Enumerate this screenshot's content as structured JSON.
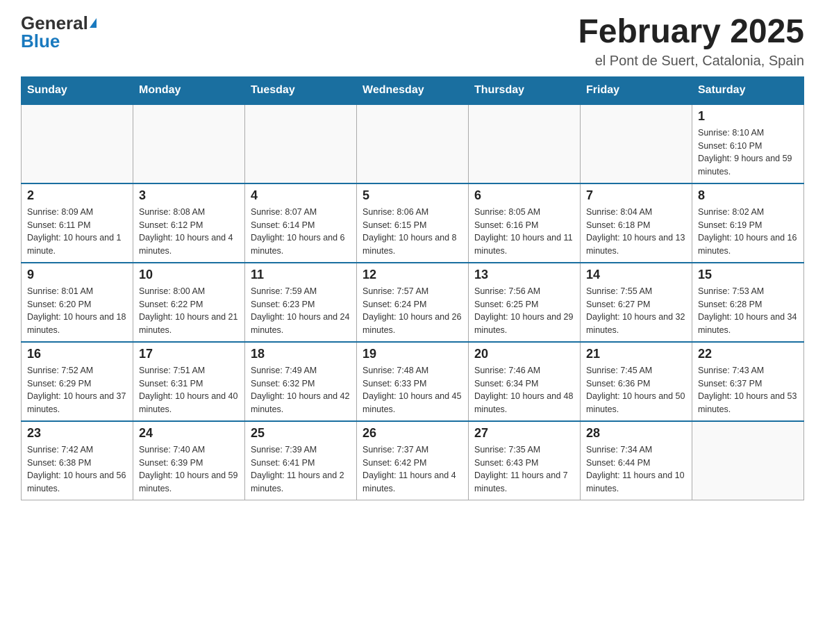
{
  "header": {
    "logo_general": "General",
    "logo_blue": "Blue",
    "title": "February 2025",
    "subtitle": "el Pont de Suert, Catalonia, Spain"
  },
  "days_of_week": [
    "Sunday",
    "Monday",
    "Tuesday",
    "Wednesday",
    "Thursday",
    "Friday",
    "Saturday"
  ],
  "weeks": [
    [
      {
        "day": "",
        "info": ""
      },
      {
        "day": "",
        "info": ""
      },
      {
        "day": "",
        "info": ""
      },
      {
        "day": "",
        "info": ""
      },
      {
        "day": "",
        "info": ""
      },
      {
        "day": "",
        "info": ""
      },
      {
        "day": "1",
        "info": "Sunrise: 8:10 AM\nSunset: 6:10 PM\nDaylight: 9 hours and 59 minutes."
      }
    ],
    [
      {
        "day": "2",
        "info": "Sunrise: 8:09 AM\nSunset: 6:11 PM\nDaylight: 10 hours and 1 minute."
      },
      {
        "day": "3",
        "info": "Sunrise: 8:08 AM\nSunset: 6:12 PM\nDaylight: 10 hours and 4 minutes."
      },
      {
        "day": "4",
        "info": "Sunrise: 8:07 AM\nSunset: 6:14 PM\nDaylight: 10 hours and 6 minutes."
      },
      {
        "day": "5",
        "info": "Sunrise: 8:06 AM\nSunset: 6:15 PM\nDaylight: 10 hours and 8 minutes."
      },
      {
        "day": "6",
        "info": "Sunrise: 8:05 AM\nSunset: 6:16 PM\nDaylight: 10 hours and 11 minutes."
      },
      {
        "day": "7",
        "info": "Sunrise: 8:04 AM\nSunset: 6:18 PM\nDaylight: 10 hours and 13 minutes."
      },
      {
        "day": "8",
        "info": "Sunrise: 8:02 AM\nSunset: 6:19 PM\nDaylight: 10 hours and 16 minutes."
      }
    ],
    [
      {
        "day": "9",
        "info": "Sunrise: 8:01 AM\nSunset: 6:20 PM\nDaylight: 10 hours and 18 minutes."
      },
      {
        "day": "10",
        "info": "Sunrise: 8:00 AM\nSunset: 6:22 PM\nDaylight: 10 hours and 21 minutes."
      },
      {
        "day": "11",
        "info": "Sunrise: 7:59 AM\nSunset: 6:23 PM\nDaylight: 10 hours and 24 minutes."
      },
      {
        "day": "12",
        "info": "Sunrise: 7:57 AM\nSunset: 6:24 PM\nDaylight: 10 hours and 26 minutes."
      },
      {
        "day": "13",
        "info": "Sunrise: 7:56 AM\nSunset: 6:25 PM\nDaylight: 10 hours and 29 minutes."
      },
      {
        "day": "14",
        "info": "Sunrise: 7:55 AM\nSunset: 6:27 PM\nDaylight: 10 hours and 32 minutes."
      },
      {
        "day": "15",
        "info": "Sunrise: 7:53 AM\nSunset: 6:28 PM\nDaylight: 10 hours and 34 minutes."
      }
    ],
    [
      {
        "day": "16",
        "info": "Sunrise: 7:52 AM\nSunset: 6:29 PM\nDaylight: 10 hours and 37 minutes."
      },
      {
        "day": "17",
        "info": "Sunrise: 7:51 AM\nSunset: 6:31 PM\nDaylight: 10 hours and 40 minutes."
      },
      {
        "day": "18",
        "info": "Sunrise: 7:49 AM\nSunset: 6:32 PM\nDaylight: 10 hours and 42 minutes."
      },
      {
        "day": "19",
        "info": "Sunrise: 7:48 AM\nSunset: 6:33 PM\nDaylight: 10 hours and 45 minutes."
      },
      {
        "day": "20",
        "info": "Sunrise: 7:46 AM\nSunset: 6:34 PM\nDaylight: 10 hours and 48 minutes."
      },
      {
        "day": "21",
        "info": "Sunrise: 7:45 AM\nSunset: 6:36 PM\nDaylight: 10 hours and 50 minutes."
      },
      {
        "day": "22",
        "info": "Sunrise: 7:43 AM\nSunset: 6:37 PM\nDaylight: 10 hours and 53 minutes."
      }
    ],
    [
      {
        "day": "23",
        "info": "Sunrise: 7:42 AM\nSunset: 6:38 PM\nDaylight: 10 hours and 56 minutes."
      },
      {
        "day": "24",
        "info": "Sunrise: 7:40 AM\nSunset: 6:39 PM\nDaylight: 10 hours and 59 minutes."
      },
      {
        "day": "25",
        "info": "Sunrise: 7:39 AM\nSunset: 6:41 PM\nDaylight: 11 hours and 2 minutes."
      },
      {
        "day": "26",
        "info": "Sunrise: 7:37 AM\nSunset: 6:42 PM\nDaylight: 11 hours and 4 minutes."
      },
      {
        "day": "27",
        "info": "Sunrise: 7:35 AM\nSunset: 6:43 PM\nDaylight: 11 hours and 7 minutes."
      },
      {
        "day": "28",
        "info": "Sunrise: 7:34 AM\nSunset: 6:44 PM\nDaylight: 11 hours and 10 minutes."
      },
      {
        "day": "",
        "info": ""
      }
    ]
  ]
}
